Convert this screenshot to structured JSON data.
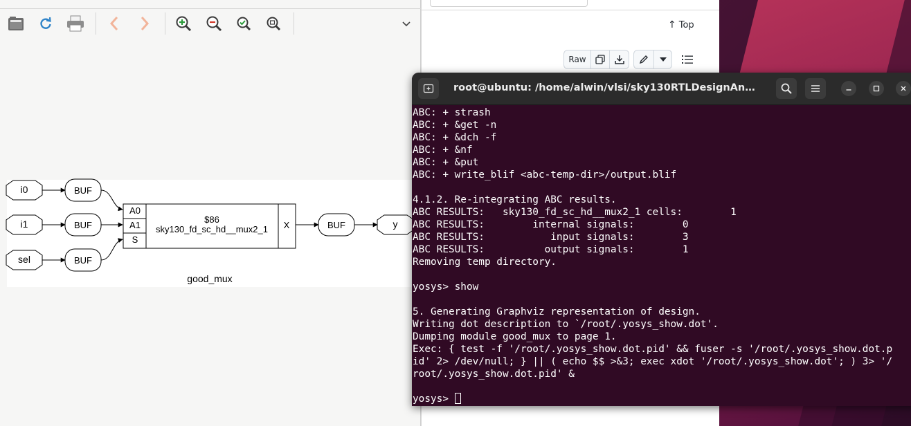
{
  "browser": {
    "top_link": "Top",
    "raw_label": "Raw"
  },
  "graph": {
    "module_name": "good_mux",
    "inputs": [
      "i0",
      "i1",
      "sel"
    ],
    "buffer_label": "BUF",
    "cell_id": "$86",
    "cell_type": "sky130_fd_sc_hd__mux2_1",
    "cell_pins": [
      "A0",
      "A1",
      "S"
    ],
    "cell_out_pin": "X",
    "output": "y"
  },
  "terminal": {
    "title": "root@ubuntu: /home/alwin/vlsi/sky130RTLDesignAndSynth...",
    "lines": [
      "ABC: + strash",
      "ABC: + &get -n",
      "ABC: + &dch -f",
      "ABC: + &nf",
      "ABC: + &put",
      "ABC: + write_blif <abc-temp-dir>/output.blif",
      "",
      "4.1.2. Re-integrating ABC results.",
      "ABC RESULTS:   sky130_fd_sc_hd__mux2_1 cells:        1",
      "ABC RESULTS:        internal signals:        0",
      "ABC RESULTS:           input signals:        3",
      "ABC RESULTS:          output signals:        1",
      "Removing temp directory.",
      "",
      "yosys> show",
      "",
      "5. Generating Graphviz representation of design.",
      "Writing dot description to `/root/.yosys_show.dot'.",
      "Dumping module good_mux to page 1.",
      "Exec: { test -f '/root/.yosys_show.dot.pid' && fuser -s '/root/.yosys_show.dot.p",
      "id' 2> /dev/null; } || ( echo $$ >&3; exec xdot '/root/.yosys_show.dot'; ) 3> '/",
      "root/.yosys_show.dot.pid' &",
      ""
    ],
    "prompt": "yosys> "
  },
  "colors": {
    "terminal_bg": "#300a24",
    "terminal_header": "#2b2b2b",
    "desktop_accent": "#c8375f"
  },
  "icons": [
    "open-file-icon",
    "reload-icon",
    "print-icon",
    "back-icon",
    "forward-icon",
    "zoom-in-icon",
    "zoom-out-icon",
    "zoom-fit-icon",
    "zoom-100-icon",
    "chevron-down-icon"
  ]
}
